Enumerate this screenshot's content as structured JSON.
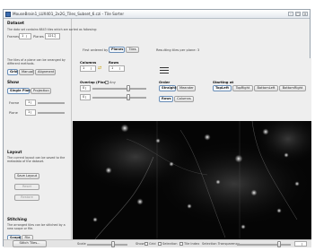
{
  "window": {
    "title": "MouseBrain1_LUX401_2x2G_Tiles_Subset_6.czi - Tile Sorter"
  },
  "dataset": {
    "heading": "Dataset",
    "info": "The data set contains 6843 tiles which are sorted as following:",
    "frames_label": "Frames",
    "frames_value": "1",
    "planes_label": "Planes",
    "planes_value": "1217",
    "first_ordered_label": "First ordered by",
    "order_planes": "Planes",
    "order_tiles": "Tiles",
    "resulting": "Resulting tiles per plane: 3"
  },
  "arrangement": {
    "text": "The tiles of a plane can be arranged by different methods.",
    "grid": "Grid",
    "manual": "Manual",
    "alignment": "Alignment"
  },
  "show": {
    "heading": "Show",
    "single_plane": "Single Plane",
    "projection": "Projection",
    "frame_label": "Frame",
    "frame_value": "1",
    "plane_label": "Plane",
    "plane_value": "1"
  },
  "layout": {
    "heading": "Layout",
    "text": "The current layout can be saved to the metadata of the dataset.",
    "save": "Save Layout",
    "reset": "Reset",
    "restore": "Restore"
  },
  "stitching": {
    "heading": "Stitching",
    "text": "The arranged tiles can be stitched by a new scope or file.",
    "scope": "Scope",
    "file": "File",
    "stitch_button": "Stitch Tiles..."
  },
  "grid_settings": {
    "columns_label": "Columns",
    "columns_value": "1",
    "rows_label": "Rows",
    "rows_value": "1",
    "overlap_label": "Overlap (Pixel)",
    "overlap_checkbox": "Any",
    "overlap_x_value": "0",
    "overlap_y_value": "0",
    "order_label": "Order",
    "order_straight": "Straight",
    "order_meander": "Meander",
    "order_rows": "Rows",
    "order_columns": "Columns",
    "starting_label": "Starting at",
    "start_topleft": "TopLeft",
    "start_topright": "TopRight",
    "start_bottomleft": "BottomLeft",
    "start_bottomright": "BottomRight"
  },
  "bottom": {
    "scale_label": "Scale",
    "show_label": "Show",
    "grid_label": "Grid",
    "selection_label": "Selection",
    "tile_index_label": "Tile Index",
    "transparency_label": "Selection Transparency"
  },
  "icons": {
    "app": "app-icon",
    "swap": "swap-arrows-icon",
    "lines": "lines-icon"
  },
  "colors": {
    "accent": "#6b8fb8",
    "viewer_bg": "#000000"
  }
}
